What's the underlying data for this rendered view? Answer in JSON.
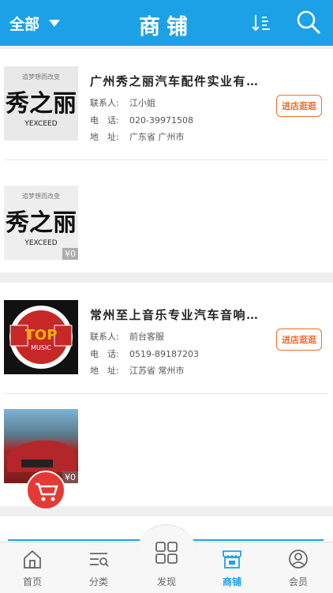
{
  "topbar": {
    "filter_label": "全部",
    "title": "商铺",
    "sort_icon": "sort-icon",
    "search_icon": "search-icon"
  },
  "shops": [
    {
      "name": "广州秀之丽汽车配件实业有…",
      "contact_label": "联系人:",
      "contact": "江小姐",
      "phone_label": "电　话:",
      "phone": "020-39971508",
      "address_label": "地　址:",
      "address": "广东省 广州市",
      "visit_label": "进店逛逛",
      "logo_text": "秀之丽",
      "logo_sub": "YEXCEED",
      "logo_top": "追梦想而改变",
      "product_price": "¥0"
    },
    {
      "name": "常州至上音乐专业汽车音响…",
      "contact_label": "联系人:",
      "contact": "前台客服",
      "phone_label": "电　话:",
      "phone": "0519-89187203",
      "address_label": "地　址:",
      "address": "江苏省 常州市",
      "visit_label": "进店逛逛",
      "logo_text": "TOP",
      "logo_sub": "MUSIC",
      "product_price": "¥0"
    }
  ],
  "tabs": [
    {
      "label": "首页",
      "icon": "home-icon"
    },
    {
      "label": "分类",
      "icon": "category-icon"
    },
    {
      "label": "发现",
      "icon": "discover-icon"
    },
    {
      "label": "商铺",
      "icon": "shop-icon",
      "active": true
    },
    {
      "label": "会员",
      "icon": "member-icon"
    }
  ],
  "colors": {
    "accent": "#1da1e6",
    "visit": "#ef6b2f"
  }
}
